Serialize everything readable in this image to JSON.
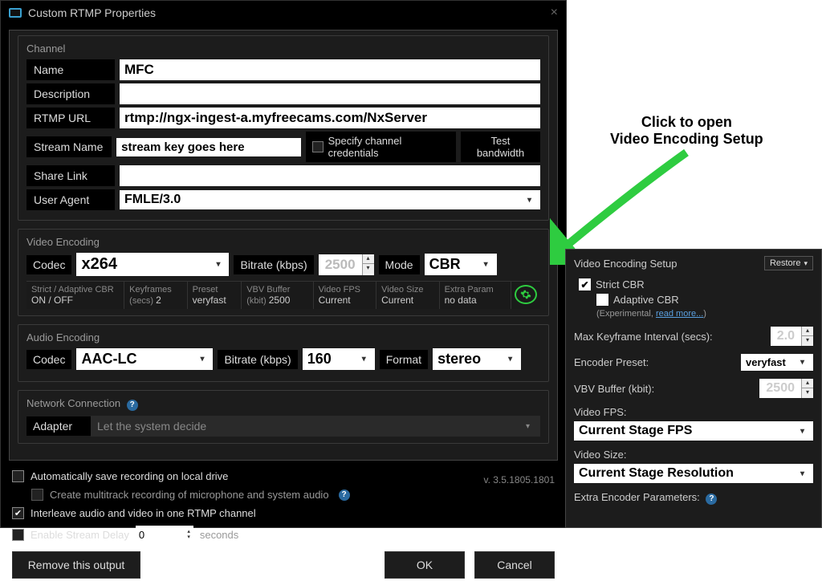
{
  "window": {
    "title": "Custom RTMP Properties"
  },
  "channel": {
    "section_title": "Channel",
    "name_label": "Name",
    "name_value": "MFC",
    "description_label": "Description",
    "description_value": "",
    "rtmp_label": "RTMP URL",
    "rtmp_value": "rtmp://ngx-ingest-a.myfreecams.com/NxServer",
    "stream_label": "Stream Name",
    "stream_value": "stream key goes here",
    "specify_creds": "Specify channel credentials",
    "test_bandwidth": "Test bandwidth",
    "share_label": "Share Link",
    "share_value": "",
    "agent_label": "User Agent",
    "agent_value": "FMLE/3.0"
  },
  "video": {
    "section_title": "Video Encoding",
    "codec_label": "Codec",
    "codec_value": "x264",
    "bitrate_label": "Bitrate (kbps)",
    "bitrate_value": "2500",
    "mode_label": "Mode",
    "mode_value": "CBR",
    "strip": {
      "c1_label": "Strict / Adaptive CBR",
      "c1_value": "ON / OFF",
      "c2_label": "Keyframes",
      "c2_sub": "(secs)",
      "c2_value": "2",
      "c3_label": "Preset",
      "c3_value": "veryfast",
      "c4_label": "VBV Buffer",
      "c4_sub": "(kbit)",
      "c4_value": "2500",
      "c5_label": "Video FPS",
      "c5_value": "Current",
      "c6_label": "Video Size",
      "c6_value": "Current",
      "c7_label": "Extra Param",
      "c7_value": "no data"
    }
  },
  "audio": {
    "section_title": "Audio Encoding",
    "codec_label": "Codec",
    "codec_value": "AAC-LC",
    "bitrate_label": "Bitrate (kbps)",
    "bitrate_value": "160",
    "format_label": "Format",
    "format_value": "stereo"
  },
  "network": {
    "section_title": "Network Connection",
    "adapter_label": "Adapter",
    "adapter_value": "Let the system decide"
  },
  "options": {
    "auto_save": "Automatically save recording on local drive",
    "multitrack": "Create multitrack recording of microphone and system audio",
    "interleave": "Interleave audio and video in one RTMP channel",
    "enable_delay": "Enable Stream Delay",
    "delay_value": "0",
    "delay_unit": "seconds",
    "version": "v. 3.5.1805.1801"
  },
  "footer": {
    "remove": "Remove this output",
    "ok": "OK",
    "cancel": "Cancel"
  },
  "annotation": {
    "line1": "Click to open",
    "line2": "Video Encoding Setup"
  },
  "setup": {
    "title": "Video Encoding Setup",
    "restore": "Restore",
    "strict_cbr": "Strict CBR",
    "adaptive_cbr": "Adaptive CBR",
    "adaptive_note_a": "(Experimental, ",
    "adaptive_note_link": "read more...",
    "adaptive_note_b": ")",
    "keyframe_label": "Max Keyframe Interval (secs):",
    "keyframe_value": "2.0",
    "preset_label": "Encoder Preset:",
    "preset_value": "veryfast",
    "vbv_label": "VBV Buffer (kbit):",
    "vbv_value": "2500",
    "fps_label": "Video FPS:",
    "fps_value": "Current Stage FPS",
    "size_label": "Video Size:",
    "size_value": "Current Stage Resolution",
    "extra_label": "Extra Encoder Parameters:"
  }
}
